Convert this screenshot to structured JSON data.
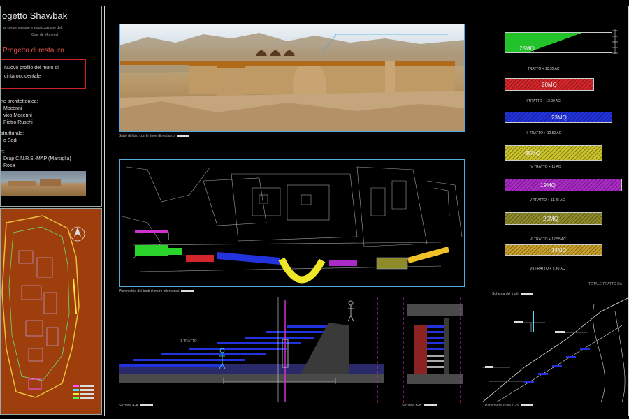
{
  "title": "ogetto Shawbak",
  "subtitle_line1": "a, conservazione e valorizzazione del",
  "subtitle_line2": "Crac de Montréal",
  "section_title": "Progetto di restauro",
  "box_text_line1": "Nuovo profilo del muro di",
  "box_text_line2": "cinta occidentale",
  "credits": [
    "ne architettonica:",
    "Mocenni",
    "vico Mocenni",
    "Pietro Ruschi",
    "strutturale:",
    "o Sodi",
    "ri:",
    "Drap C.N.R.S.-MAP (Marsiglia)",
    "Rose"
  ],
  "photo_caption": "Stato di fatto con le linee di restauro",
  "plan_caption": "Planimetria dei tratti di muro interessati",
  "section_aa_label": "Sezione A-A'",
  "section_bb_label": "Sezione B-B'",
  "detail_label": "Particolare scala 1:25",
  "scheme_title": "Schema dei tratti",
  "tratto_label": "1 TRATTO",
  "totals_label": "TOTALE   TRATTO DA",
  "bars": [
    {
      "label": "25MQ",
      "sub": "I  TRATTO + 10.35 AC",
      "color": "#22c22a"
    },
    {
      "label": "20MQ",
      "sub": "II  TRATTO + 12.00 AC",
      "color": "#d4262a"
    },
    {
      "label": "23MQ",
      "sub": "III  TRATTO + 12.50 AC",
      "color": "#2233dd"
    },
    {
      "label": "35MQ",
      "sub": "IV  TRATTO + 11 AC",
      "color": "#c9c22a"
    },
    {
      "label": "19MQ",
      "sub": "V  TRATTO + 11.45 AC",
      "color": "#a92ac4"
    },
    {
      "label": "20MQ",
      "sub": "VI  TRATTO + 12.55 AC",
      "color": "#8f8a2a"
    },
    {
      "label": "14MQ",
      "sub": "VII  TRATTO + 9.40 AC",
      "color": "#c8a02a"
    }
  ]
}
